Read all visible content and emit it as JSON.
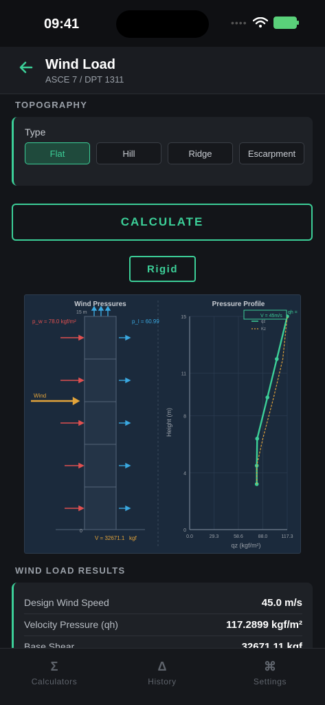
{
  "status": {
    "time": "09:41",
    "signal": "••••"
  },
  "header": {
    "title": "Wind Load",
    "subtitle": "ASCE 7 / DPT 1311"
  },
  "topography": {
    "section_title": "TOPOGRAPHY",
    "type_label": "Type",
    "options": [
      "Flat",
      "Hill",
      "Ridge",
      "Escarpment"
    ],
    "selected": "Flat"
  },
  "calculate_label": "CALCULATE",
  "rigid_label": "Rigid",
  "diagram": {
    "left_title": "Wind Pressures",
    "height_label": "15 m",
    "pw_label": "p_w =  78.0 kgf/m²",
    "pl_label": "p_l = 60.99",
    "wind_label": "Wind",
    "zero_label": "0",
    "base_label": "V = 32671.1",
    "base_unit": "kgf",
    "right_title": "Pressure Profile",
    "legend_v": "V = 45m/s",
    "legend_qz": "qz",
    "legend_kz": "Kz",
    "qh_label": "qh =",
    "ylabel": "Height (m)",
    "xlabel": "qz (kgf/m²)"
  },
  "chart_data": {
    "type": "line",
    "title": "Pressure Profile",
    "xlabel": "qz (kgf/m²)",
    "ylabel": "Height (m)",
    "xlim": [
      0,
      117.3
    ],
    "ylim": [
      0,
      15
    ],
    "x_ticks": [
      "0.0",
      "29.3",
      "58.6",
      "88.0",
      "117.3"
    ],
    "y_ticks": [
      "0",
      "4",
      "8",
      "11",
      "15"
    ],
    "series": [
      {
        "name": "qz",
        "x": [
          80.7,
          80.7,
          81.2,
          93.5,
          104.8,
          117.3
        ],
        "y": [
          3.2,
          4.5,
          6.4,
          9.3,
          12.0,
          15.0
        ],
        "color": "#3ccf98"
      },
      {
        "name": "Kz",
        "x": [
          80.7,
          80.7,
          88.0,
          101.0,
          112.0,
          117.3
        ],
        "y": [
          3.2,
          4.5,
          6.4,
          9.3,
          12.0,
          15.0
        ],
        "color": "#e3a43a"
      }
    ],
    "grid": true,
    "legend": "top-right"
  },
  "results": {
    "section_title": "WIND LOAD RESULTS",
    "rows": [
      {
        "label": "Design Wind Speed",
        "value": "45.0 m/s"
      },
      {
        "label": "Velocity Pressure (qh)",
        "value": "117.2899 kgf/m²"
      },
      {
        "label": "Base Shear",
        "value": "32671.11 kgf"
      }
    ]
  },
  "tabs": [
    {
      "icon": "Σ",
      "label": "Calculators"
    },
    {
      "icon": "Δ",
      "label": "History"
    },
    {
      "icon": "⌘",
      "label": "Settings"
    }
  ],
  "colors": {
    "accent": "#3ccf98",
    "windward": "#e05050",
    "leeward": "#3aa8e0",
    "wind": "#e3a43a"
  }
}
